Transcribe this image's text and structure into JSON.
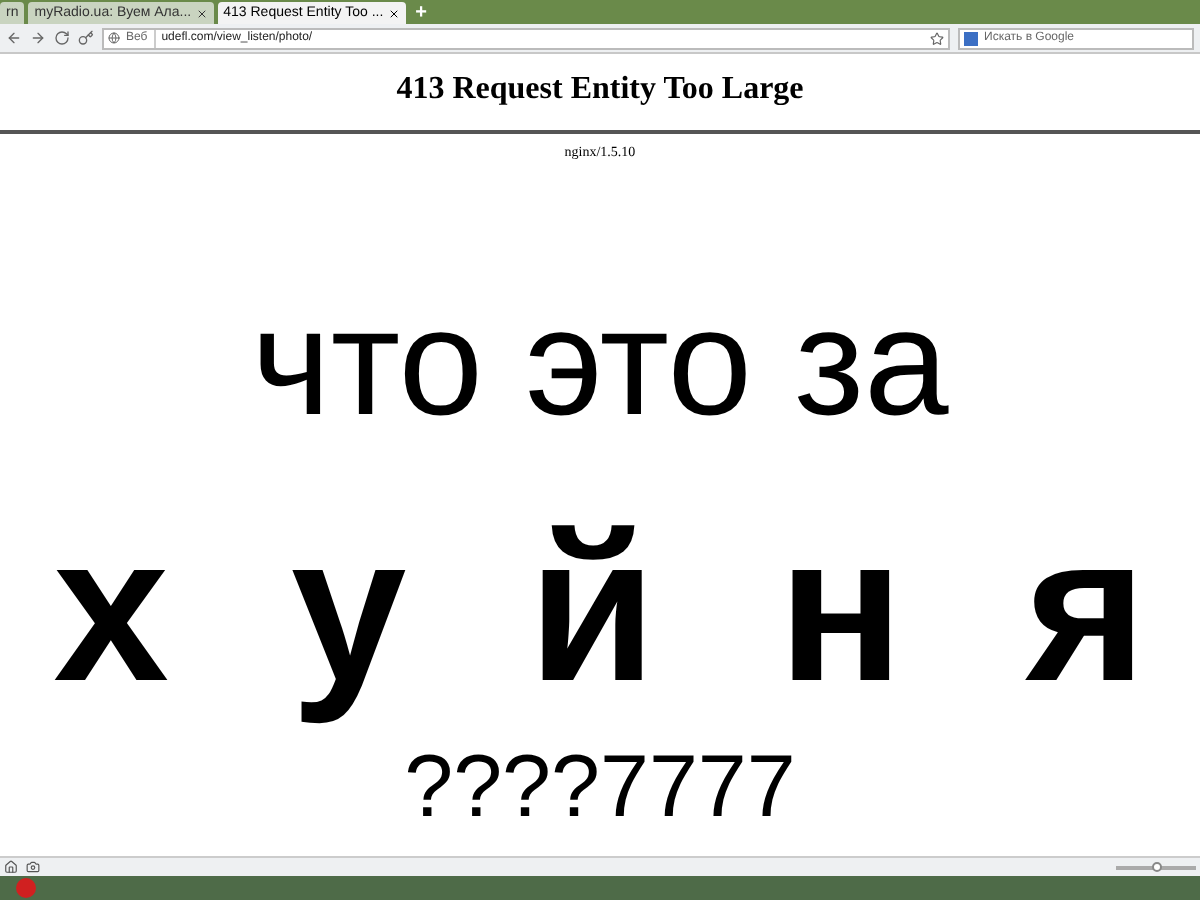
{
  "tabs": [
    {
      "label": "rn",
      "selected": false
    },
    {
      "label": "myRadio.ua: Вуем Ала...",
      "selected": false
    },
    {
      "label": "413 Request Entity Too ...",
      "selected": true
    }
  ],
  "new_tab": "+",
  "address_bar": {
    "site_label": "Веб",
    "url": "udefl.com/view_listen/photo/"
  },
  "search": {
    "placeholder": "Искать в Google"
  },
  "zoom_slider": {
    "level": 0.5
  },
  "page": {
    "title": "413 Request Entity Too Large",
    "server": "nginx/1.5.10",
    "lines": [
      {
        "kind": "regular",
        "text": "что это за"
      },
      {
        "kind": "bold",
        "text": "х у й н я"
      },
      {
        "kind": "small",
        "text": "????7777"
      }
    ]
  }
}
